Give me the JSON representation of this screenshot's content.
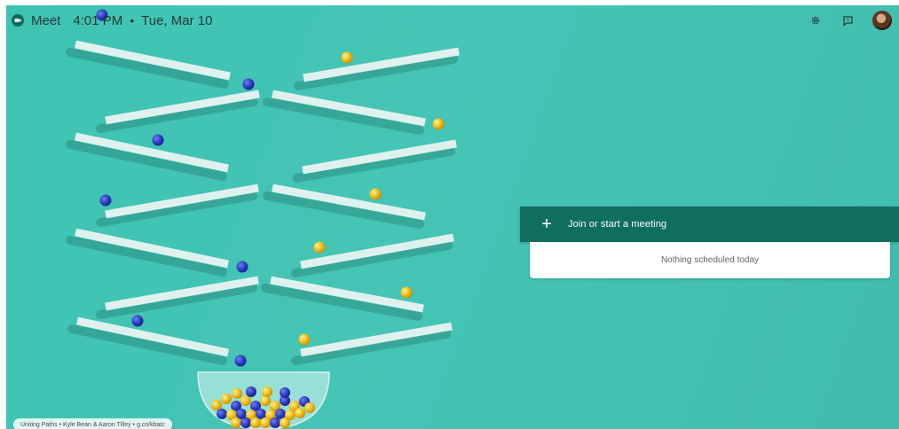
{
  "header": {
    "app_name": "Meet",
    "time": "4:01 PM",
    "separator": "•",
    "date": "Tue, Mar 10"
  },
  "toolbar": {
    "icons": [
      "settings-icon",
      "feedback-icon",
      "avatar"
    ]
  },
  "meeting": {
    "join_label": "Join or start a meeting",
    "join_icon": "plus-icon",
    "schedule_text": "Nothing scheduled today"
  },
  "background": {
    "credit": "Uniting Paths • Kyle Bean & Aaron Tilley • g.co/kbatc"
  },
  "colors": {
    "background": "#44c4b4",
    "join_bar": "#0f6e5d",
    "ball_blue": "#2f3fc4",
    "ball_yellow": "#f2c21b",
    "plank": "#dff1ee"
  }
}
